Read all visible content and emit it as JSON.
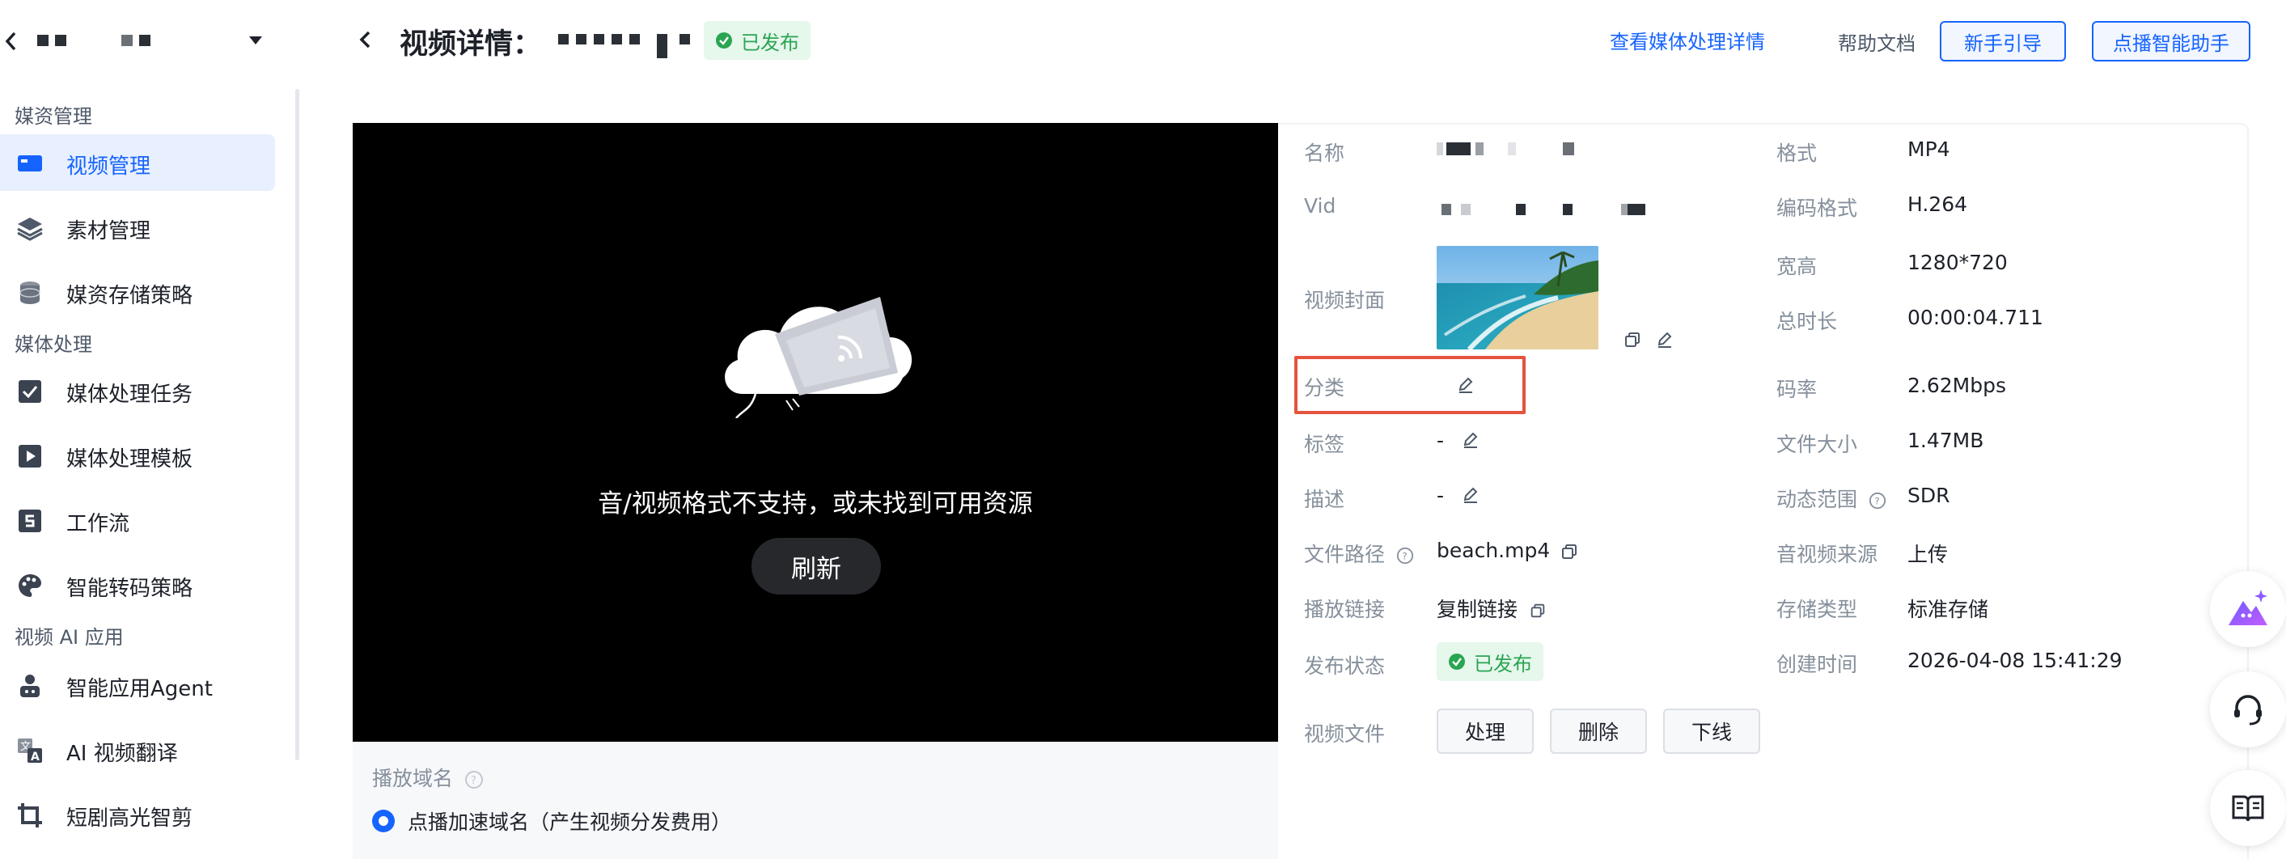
{
  "sidebar": {
    "groups": [
      {
        "label": "媒资管理"
      },
      {
        "label": "媒体处理"
      },
      {
        "label": "视频 AI 应用"
      }
    ],
    "items": [
      {
        "label": "视频管理",
        "icon": "video-icon"
      },
      {
        "label": "素材管理",
        "icon": "layers-icon"
      },
      {
        "label": "媒资存储策略",
        "icon": "database-icon"
      },
      {
        "label": "媒体处理任务",
        "icon": "task-check-icon"
      },
      {
        "label": "媒体处理模板",
        "icon": "play-template-icon"
      },
      {
        "label": "工作流",
        "icon": "workflow-icon"
      },
      {
        "label": "智能转码策略",
        "icon": "palette-icon"
      },
      {
        "label": "智能应用Agent",
        "icon": "agent-icon"
      },
      {
        "label": "AI 视频翻译",
        "icon": "translate-icon"
      },
      {
        "label": "短剧高光智剪",
        "icon": "crop-icon"
      }
    ]
  },
  "header": {
    "title": "视频详情：",
    "status_badge": "已发布",
    "media_link": "查看媒体处理详情",
    "help_docs": "帮助文档",
    "guide_button": "新手引导",
    "assistant_button": "点播智能助手"
  },
  "player": {
    "message": "音/视频格式不支持，或未找到可用资源",
    "refresh": "刷新",
    "domain_label": "播放域名",
    "domain_option": "点播加速域名（产生视频分发费用）"
  },
  "info": {
    "left": {
      "name_label": "名称",
      "vid_label": "Vid",
      "cover_label": "视频封面",
      "category_label": "分类",
      "tags_label": "标签",
      "tags_value": "-",
      "desc_label": "描述",
      "desc_value": "-",
      "path_label": "文件路径",
      "path_value": "beach.mp4",
      "play_link_label": "播放链接",
      "play_link_value": "复制链接",
      "publish_label": "发布状态",
      "publish_value": "已发布",
      "file_label": "视频文件"
    },
    "right": {
      "format_label": "格式",
      "format_value": "MP4",
      "codec_label": "编码格式",
      "codec_value": "H.264",
      "size_label": "宽高",
      "size_value": "1280*720",
      "duration_label": "总时长",
      "duration_value": "00:00:04.711",
      "bitrate_label": "码率",
      "bitrate_value": "2.62Mbps",
      "filesize_label": "文件大小",
      "filesize_value": "1.47MB",
      "range_label": "动态范围",
      "range_value": "SDR",
      "source_label": "音视频来源",
      "source_value": "上传",
      "storage_label": "存储类型",
      "storage_value": "标准存储",
      "created_label": "创建时间",
      "created_value": "2026-04-08 15:41:29"
    },
    "actions": {
      "process": "处理",
      "delete": "删除",
      "offline": "下线"
    }
  },
  "colors": {
    "primary": "#1664ff",
    "success": "#2aa552",
    "highlight": "#e5533d"
  }
}
